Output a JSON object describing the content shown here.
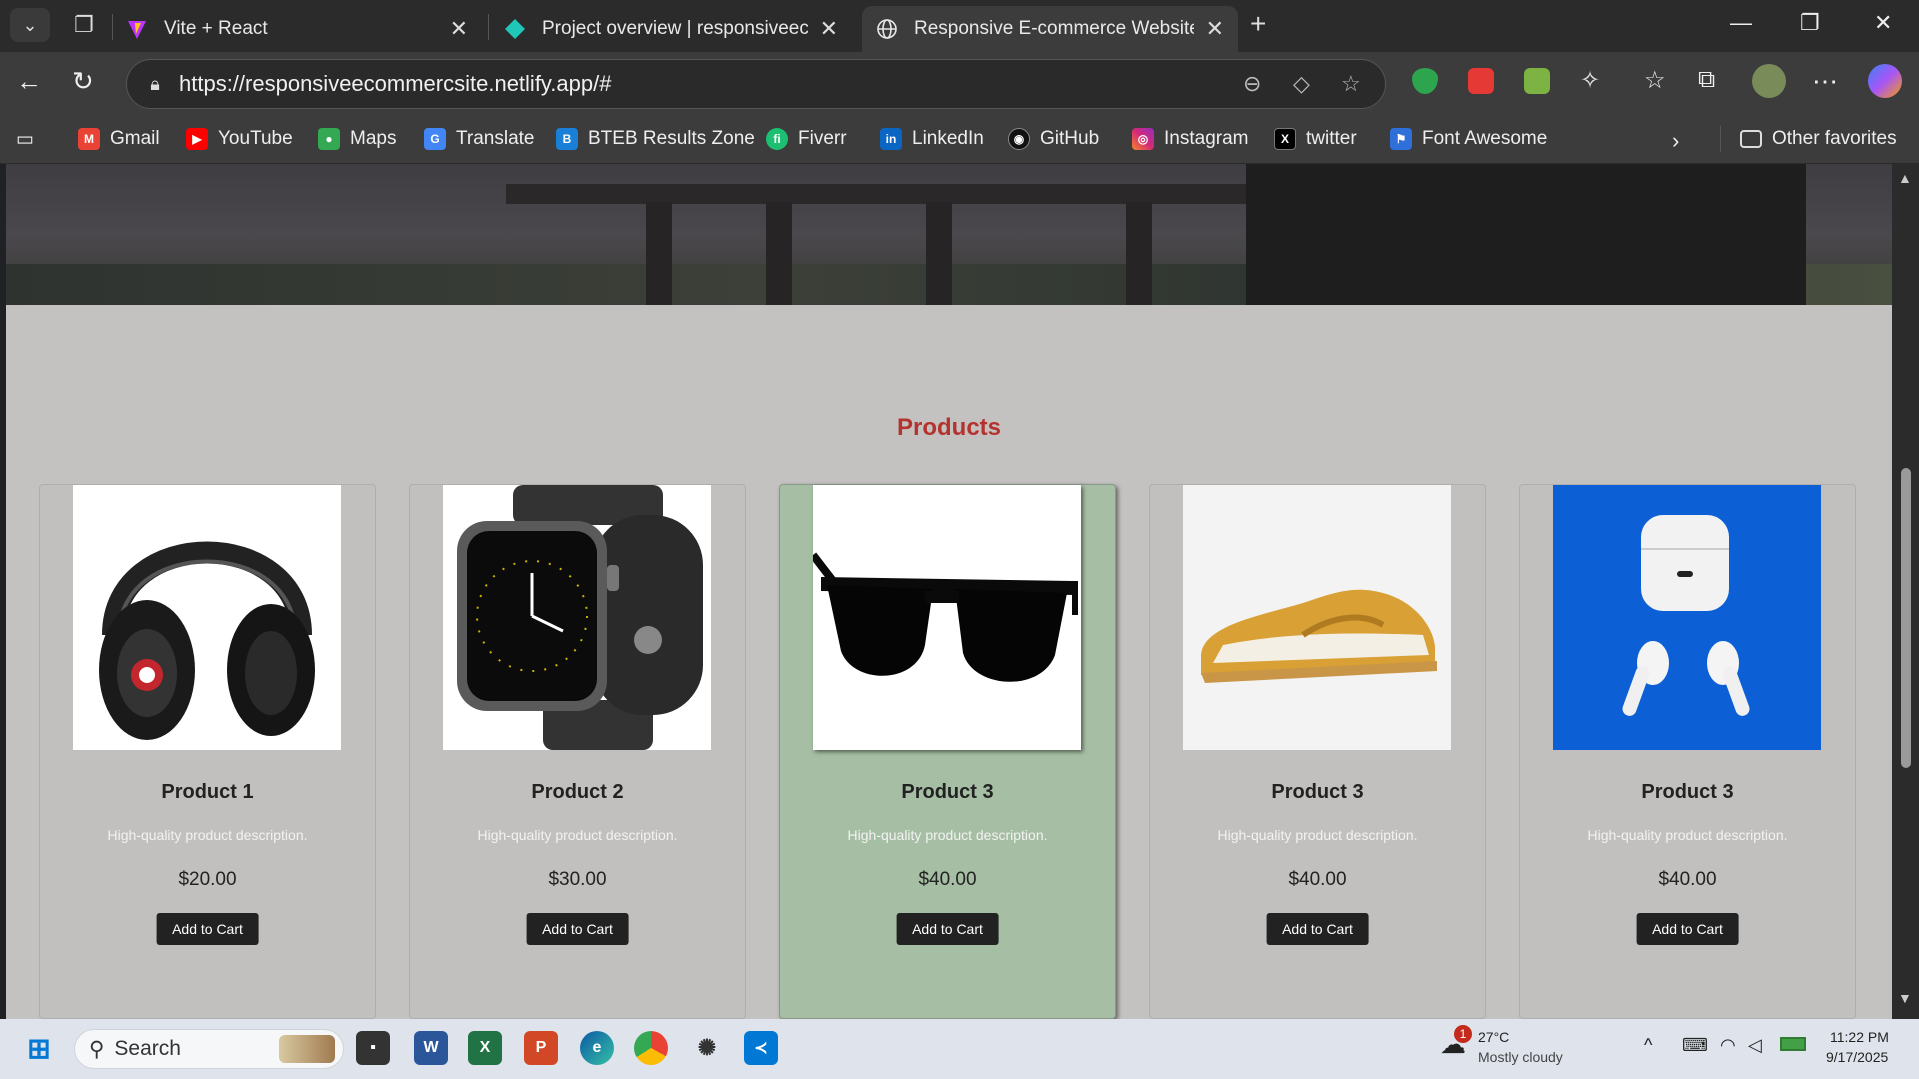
{
  "browser": {
    "tabs": [
      {
        "title": "Vite + React",
        "icon": "vite-icon",
        "active": false
      },
      {
        "title": "Project overview | responsiveecom",
        "icon": "netlify-icon",
        "active": false
      },
      {
        "title": "Responsive E-commerce Website",
        "icon": "globe-icon",
        "active": true
      }
    ],
    "url": "https://responsiveecommercsite.netlify.app/#",
    "bookmarks": [
      {
        "label": "Gmail",
        "color": "#ea4335",
        "glyph": "M"
      },
      {
        "label": "YouTube",
        "color": "#ff0000",
        "glyph": "▶"
      },
      {
        "label": "Maps",
        "color": "#34a853",
        "glyph": "⬤"
      },
      {
        "label": "Translate",
        "color": "#4285f4",
        "glyph": "G"
      },
      {
        "label": "BTEB Results Zone",
        "color": "#1a7fd6",
        "glyph": "B"
      },
      {
        "label": "Fiverr",
        "color": "#1dbf73",
        "glyph": "fi"
      },
      {
        "label": "LinkedIn",
        "color": "#0a66c2",
        "glyph": "in"
      },
      {
        "label": "GitHub",
        "color": "#111111",
        "glyph": "◉"
      },
      {
        "label": "Instagram",
        "color": "#d62976",
        "glyph": "◎"
      },
      {
        "label": "twitter",
        "color": "#000000",
        "glyph": "X"
      },
      {
        "label": "Font Awesome",
        "color": "#2f6fd9",
        "glyph": "⚑"
      }
    ],
    "other_favorites": "Other favorites"
  },
  "page": {
    "section_title": "Products",
    "products": [
      {
        "name": "Product 1",
        "description": "High-quality product description.",
        "price": "$20.00",
        "button": "Add to Cart",
        "image": "headphones"
      },
      {
        "name": "Product 2",
        "description": "High-quality product description.",
        "price": "$30.00",
        "button": "Add to Cart",
        "image": "smartwatch"
      },
      {
        "name": "Product 3",
        "description": "High-quality product description.",
        "price": "$40.00",
        "button": "Add to Cart",
        "image": "sunglasses",
        "highlighted": true
      },
      {
        "name": "Product 3",
        "description": "High-quality product description.",
        "price": "$40.00",
        "button": "Add to Cart",
        "image": "sneaker"
      },
      {
        "name": "Product 3",
        "description": "High-quality product description.",
        "price": "$40.00",
        "button": "Add to Cart",
        "image": "earbuds"
      }
    ]
  },
  "taskbar": {
    "search_label": "Search",
    "weather": {
      "temp": "27°C",
      "condition": "Mostly cloudy",
      "badge": "1"
    },
    "time": "11:22 PM",
    "date": "9/17/2025"
  },
  "colors": {
    "accent_title": "#b5332e",
    "highlight_card": "#a6bfa4",
    "button": "#222222"
  }
}
